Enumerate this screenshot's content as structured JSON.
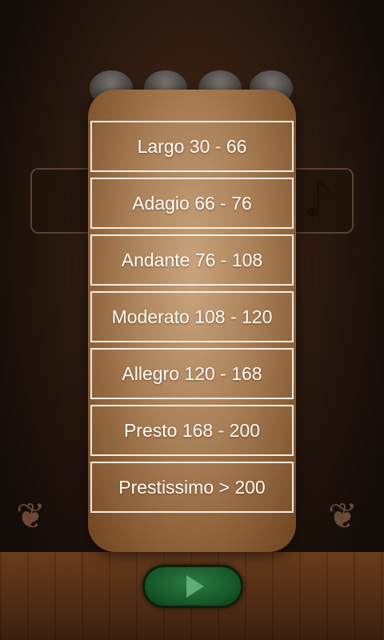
{
  "tempo_options": [
    {
      "label": "Largo 30 - 66"
    },
    {
      "label": "Adagio 66 - 76"
    },
    {
      "label": "Andante 76 - 108"
    },
    {
      "label": "Moderato 108 - 120"
    },
    {
      "label": "Allegro 120 - 168"
    },
    {
      "label": "Presto 168 - 200"
    },
    {
      "label": "Prestissimo > 200"
    }
  ],
  "icons": {
    "note": "music-note-icon",
    "play": "play-icon"
  }
}
